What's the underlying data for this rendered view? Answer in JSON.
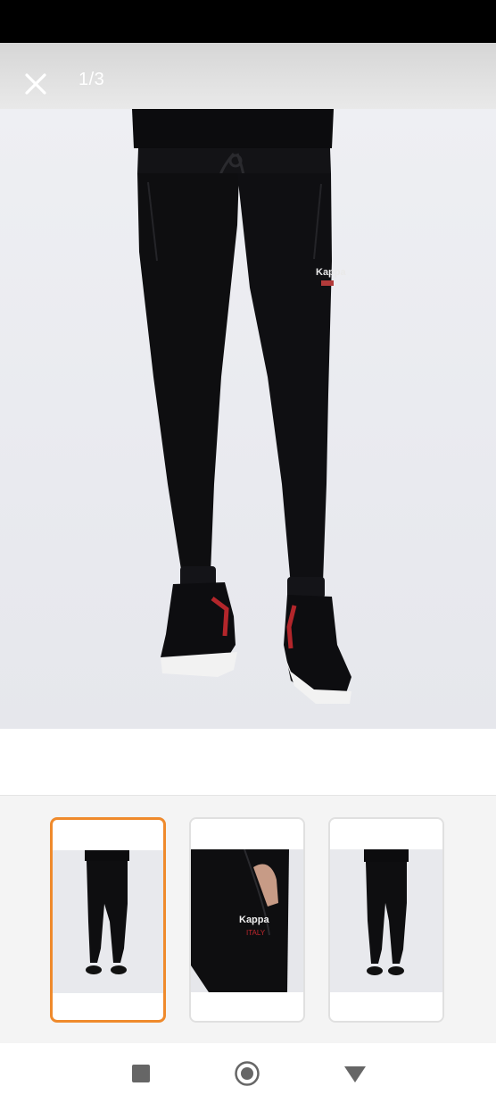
{
  "viewer": {
    "counter": "1/3",
    "close_icon": "close-icon"
  },
  "main_image": {
    "subject": "black jogger pants with sneakers",
    "logo_text": "Kappa"
  },
  "thumbnails": [
    {
      "label": "thumbnail-1",
      "active": true
    },
    {
      "label": "thumbnail-2",
      "active": false
    },
    {
      "label": "thumbnail-3",
      "active": false
    }
  ],
  "thumb_logo": {
    "brand": "Kappa",
    "sub": "ITALY"
  },
  "nav": {
    "recent_icon": "square-icon",
    "home_icon": "circle-icon",
    "back_icon": "triangle-back-icon"
  },
  "colors": {
    "accent": "#ef8a2c",
    "garment": "#0e0e10"
  }
}
